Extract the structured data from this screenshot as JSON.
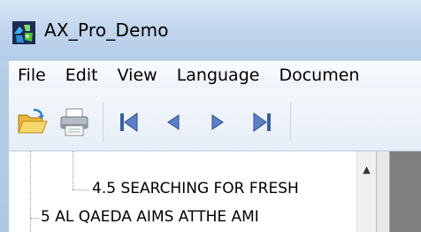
{
  "window": {
    "title": "AX_Pro_Demo",
    "app_icon": "puzzle-app-icon"
  },
  "menubar": {
    "items": [
      "File",
      "Edit",
      "View",
      "Language",
      "Documen"
    ]
  },
  "toolbar": {
    "buttons": [
      {
        "name": "open-folder-icon"
      },
      {
        "name": "print-icon"
      },
      {
        "name": "first-page-icon"
      },
      {
        "name": "previous-page-icon"
      },
      {
        "name": "next-page-icon"
      },
      {
        "name": "last-page-icon"
      }
    ]
  },
  "tree": {
    "items": [
      {
        "label": "4.5 SEARCHING FOR FRESH"
      },
      {
        "label": "5 AL QAEDA AIMS ATTHE AMI"
      }
    ]
  },
  "colors": {
    "titlebar": "#c3d7ee",
    "accent_nav": "#3a5fa8"
  }
}
